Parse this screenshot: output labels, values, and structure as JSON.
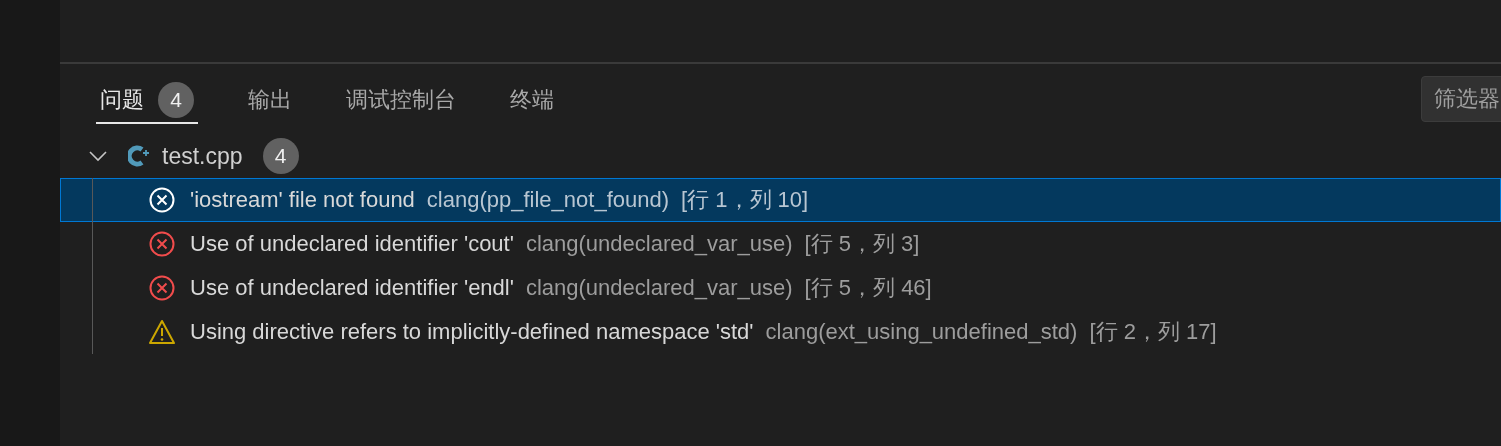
{
  "panel": {
    "tabs": [
      {
        "label": "问题",
        "badge": "4",
        "selected": true
      },
      {
        "label": "输出",
        "selected": false
      },
      {
        "label": "调试控制台",
        "selected": false
      },
      {
        "label": "终端",
        "selected": false
      }
    ],
    "filter": {
      "placeholder": "筛选器"
    }
  },
  "problems": [
    {
      "file": "test.cpp",
      "count": "4",
      "expanded": true,
      "children": [
        {
          "kind": "error",
          "message": "'iostream' file not found",
          "source": "clang(pp_file_not_found)",
          "location": "[行 1，列 10]",
          "selected": true
        },
        {
          "kind": "error",
          "message": "Use of undeclared identifier 'cout'",
          "source": "clang(undeclared_var_use)",
          "location": "[行 5，列 3]",
          "selected": false
        },
        {
          "kind": "error",
          "message": "Use of undeclared identifier 'endl'",
          "source": "clang(undeclared_var_use)",
          "location": "[行 5，列 46]",
          "selected": false
        },
        {
          "kind": "warning",
          "message": "Using directive refers to implicitly-defined namespace 'std'",
          "source": "clang(ext_using_undefined_std)",
          "location": "[行 2，列 17]",
          "selected": false
        }
      ]
    }
  ]
}
